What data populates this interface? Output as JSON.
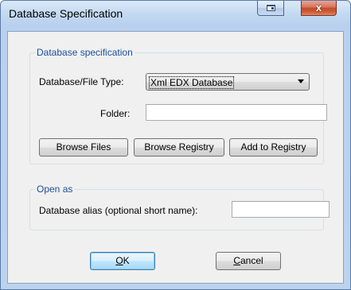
{
  "window": {
    "title": "Database Specification"
  },
  "caption_buttons": {
    "restore_icon": "restore-icon",
    "close_icon": "close-icon",
    "close_glyph": "x"
  },
  "database_group": {
    "legend": "Database specification",
    "type_label": "Database/File Type:",
    "type_value": "Xml EDX Database",
    "folder_label": "Folder:",
    "folder_value": "",
    "browse_files": "Browse Files",
    "browse_registry": "Browse Registry",
    "add_to_registry": "Add to Registry"
  },
  "open_as_group": {
    "legend": "Open as",
    "alias_label": "Database alias (optional short name):",
    "alias_value": ""
  },
  "buttons": {
    "ok_mnemonic": "O",
    "ok_rest": "K",
    "cancel_mnemonic": "C",
    "cancel_rest": "ancel"
  },
  "colors": {
    "legend_text": "#1b4f9c",
    "title_gradient_top": "#dbe9f8",
    "close_button": "#c44a2b"
  }
}
